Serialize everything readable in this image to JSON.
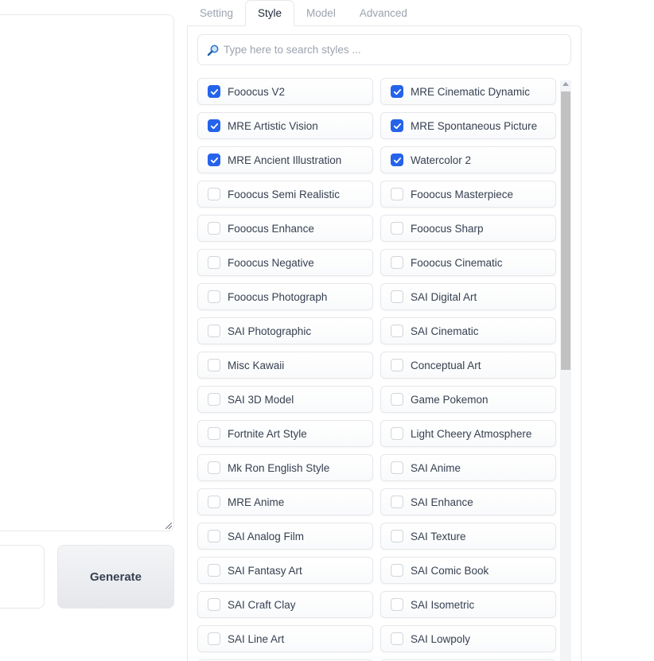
{
  "left": {
    "generate_label": "Generate"
  },
  "tabs": [
    {
      "label": "Setting",
      "active": false
    },
    {
      "label": "Style",
      "active": true
    },
    {
      "label": "Model",
      "active": false
    },
    {
      "label": "Advanced",
      "active": false
    }
  ],
  "search": {
    "placeholder": "Type here to search styles ...",
    "icon": "magnifier-icon"
  },
  "styles": [
    {
      "label": "Fooocus V2",
      "checked": true
    },
    {
      "label": "MRE Cinematic Dynamic",
      "checked": true
    },
    {
      "label": "MRE Artistic Vision",
      "checked": true
    },
    {
      "label": "MRE Spontaneous Picture",
      "checked": true
    },
    {
      "label": "MRE Ancient Illustration",
      "checked": true
    },
    {
      "label": "Watercolor 2",
      "checked": true
    },
    {
      "label": "Fooocus Semi Realistic",
      "checked": false
    },
    {
      "label": "Fooocus Masterpiece",
      "checked": false
    },
    {
      "label": "Fooocus Enhance",
      "checked": false
    },
    {
      "label": "Fooocus Sharp",
      "checked": false
    },
    {
      "label": "Fooocus Negative",
      "checked": false
    },
    {
      "label": "Fooocus Cinematic",
      "checked": false
    },
    {
      "label": "Fooocus Photograph",
      "checked": false
    },
    {
      "label": "SAI Digital Art",
      "checked": false
    },
    {
      "label": "SAI Photographic",
      "checked": false
    },
    {
      "label": "SAI Cinematic",
      "checked": false
    },
    {
      "label": "Misc Kawaii",
      "checked": false
    },
    {
      "label": "Conceptual Art",
      "checked": false
    },
    {
      "label": "SAI 3D Model",
      "checked": false
    },
    {
      "label": "Game Pokemon",
      "checked": false
    },
    {
      "label": "Fortnite Art Style",
      "checked": false
    },
    {
      "label": "Light Cheery Atmosphere",
      "checked": false
    },
    {
      "label": "Mk Ron English Style",
      "checked": false
    },
    {
      "label": "SAI Anime",
      "checked": false
    },
    {
      "label": "MRE Anime",
      "checked": false
    },
    {
      "label": "SAI Enhance",
      "checked": false
    },
    {
      "label": "SAI Analog Film",
      "checked": false
    },
    {
      "label": "SAI Texture",
      "checked": false
    },
    {
      "label": "SAI Fantasy Art",
      "checked": false
    },
    {
      "label": "SAI Comic Book",
      "checked": false
    },
    {
      "label": "SAI Craft Clay",
      "checked": false
    },
    {
      "label": "SAI Isometric",
      "checked": false
    },
    {
      "label": "SAI Line Art",
      "checked": false
    },
    {
      "label": "SAI Lowpoly",
      "checked": false
    },
    {
      "label": "",
      "checked": false
    },
    {
      "label": "",
      "checked": false
    }
  ],
  "colors": {
    "accent": "#2563eb",
    "border": "#e5e7eb"
  }
}
